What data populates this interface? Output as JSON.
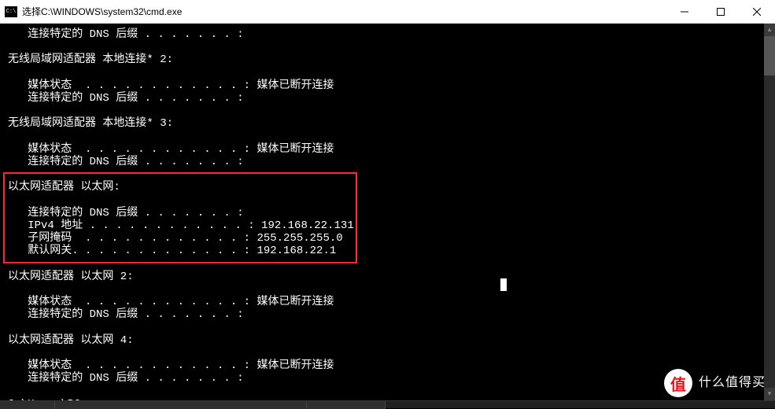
{
  "title": "选择C:\\WINDOWS\\system32\\cmd.exe",
  "output": {
    "l1": "   连接特定的 DNS 后缀 . . . . . . . :",
    "l2": "",
    "l3": "无线局域网适配器 本地连接* 2:",
    "l4": "",
    "l5": "   媒体状态  . . . . . . . . . . . . : 媒体已断开连接",
    "l6": "   连接特定的 DNS 后缀 . . . . . . . :",
    "l7": "",
    "l8": "无线局域网适配器 本地连接* 3:",
    "l9": "",
    "l10": "   媒体状态  . . . . . . . . . . . . : 媒体已断开连接",
    "l11": "   连接特定的 DNS 后缀 . . . . . . . :",
    "l12": "",
    "l13": "以太网适配器 以太网:",
    "l14": "",
    "l15": "   连接特定的 DNS 后缀 . . . . . . . :",
    "l16": "   IPv4 地址 . . . . . . . . . . . . : 192.168.22.131",
    "l17": "   子网掩码  . . . . . . . . . . . . : 255.255.255.0",
    "l18": "   默认网关. . . . . . . . . . . . . : 192.168.22.1",
    "l19": "",
    "l20": "以太网适配器 以太网 2:",
    "l21": "",
    "l22": "   媒体状态  . . . . . . . . . . . . : 媒体已断开连接",
    "l23": "   连接特定的 DNS 后缀 . . . . . . . :",
    "l24": "",
    "l25": "以太网适配器 以太网 4:",
    "l26": "",
    "l27": "   媒体状态  . . . . . . . . . . . . : 媒体已断开连接",
    "l28": "   连接特定的 DNS 后缀 . . . . . . . :",
    "l29": "",
    "l30": "C:\\Users\\PC>_"
  },
  "watermark": {
    "icon_text": "值",
    "line1": "什么值得买",
    "line2": ""
  }
}
